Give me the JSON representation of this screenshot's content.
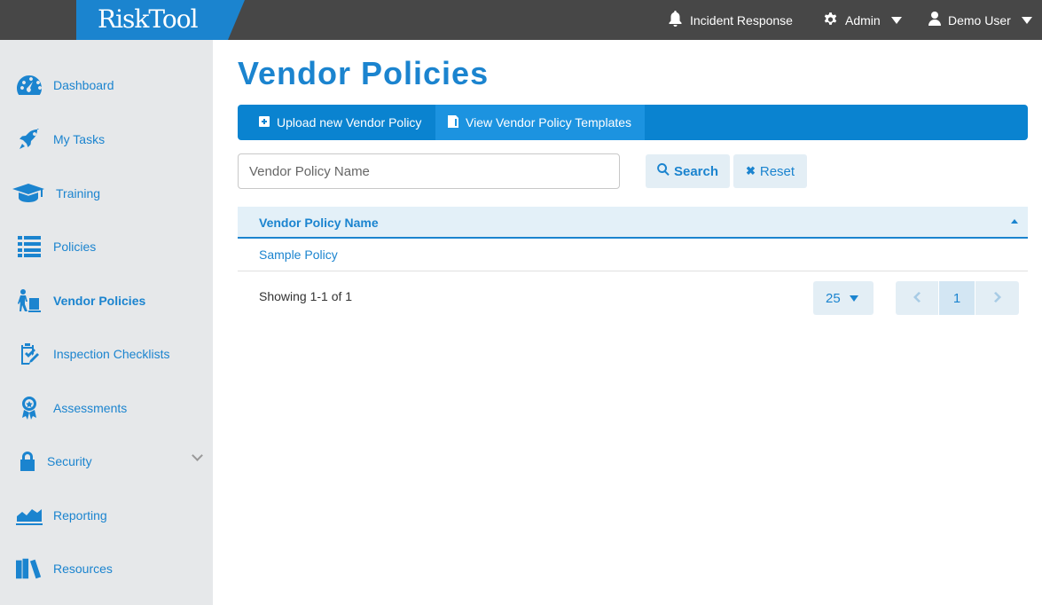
{
  "app": {
    "logo_text": "RiskTool",
    "accent": "#1b84cf"
  },
  "topbar": {
    "incident": {
      "label": "Incident Response",
      "icon": "bell-icon"
    },
    "admin": {
      "label": "Admin",
      "icon": "gear-icon"
    },
    "user": {
      "label": "Demo User",
      "icon": "user-icon"
    }
  },
  "sidebar": {
    "items": [
      {
        "label": "Dashboard",
        "icon": "speedometer-icon"
      },
      {
        "label": "My Tasks",
        "icon": "rocket-icon"
      },
      {
        "label": "Training",
        "icon": "graduation-cap-icon"
      },
      {
        "label": "Policies",
        "icon": "list-icon"
      },
      {
        "label": "Vendor Policies",
        "icon": "vendor-cart-icon",
        "active": true
      },
      {
        "label": "Inspection Checklists",
        "icon": "clipboard-check-icon"
      },
      {
        "label": "Assessments",
        "icon": "award-ribbon-icon"
      },
      {
        "label": "Security",
        "icon": "lock-icon",
        "expandable": true
      },
      {
        "label": "Reporting",
        "icon": "area-chart-icon"
      },
      {
        "label": "Resources",
        "icon": "books-icon"
      }
    ]
  },
  "main": {
    "title": "Vendor Policies",
    "actions": {
      "upload": "Upload new Vendor Policy",
      "templates": "View Vendor Policy Templates"
    },
    "search": {
      "placeholder": "Vendor Policy Name",
      "value": "",
      "search_label": "Search",
      "reset_label": "Reset"
    },
    "table": {
      "columns": [
        "Vendor Policy Name"
      ],
      "rows": [
        [
          "Sample Policy"
        ]
      ]
    },
    "footer": {
      "showing": "Showing 1-1 of 1",
      "per_page": "25",
      "current_page": "1"
    }
  }
}
